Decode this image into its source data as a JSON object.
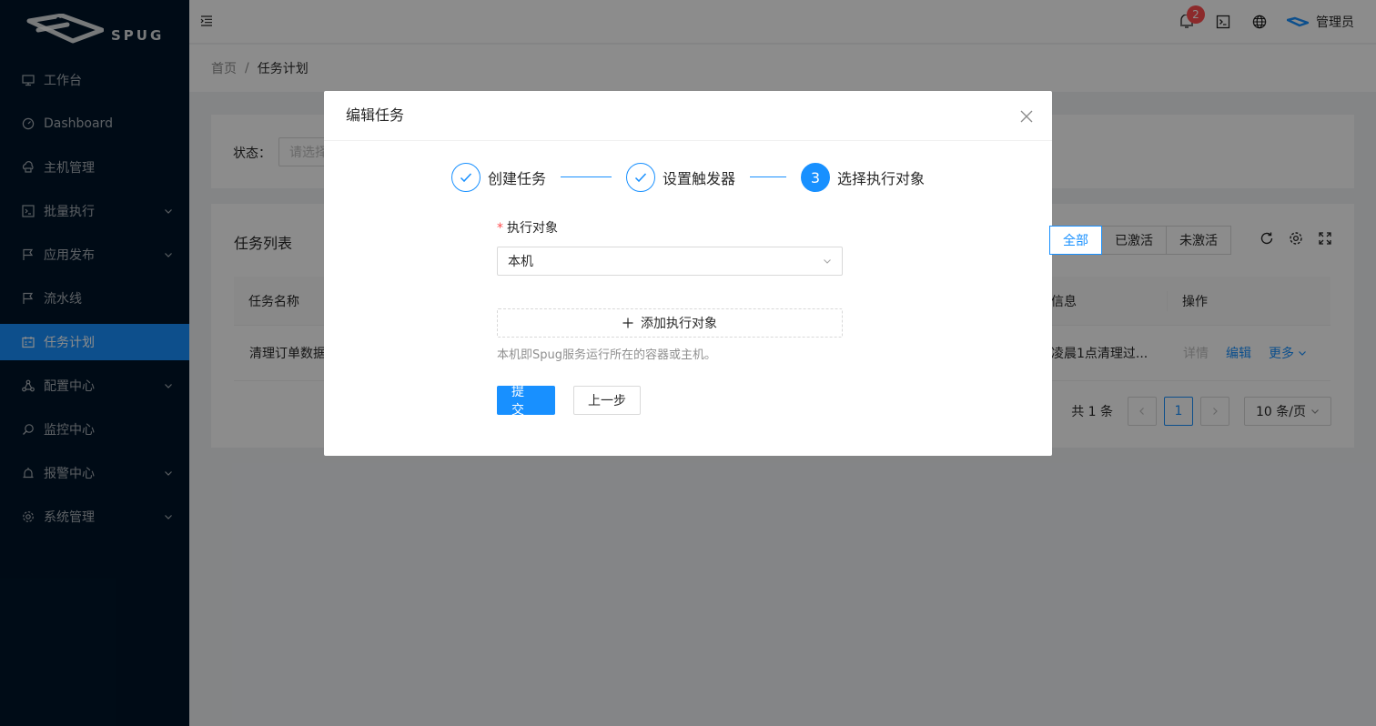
{
  "app": {
    "logo_text": "SPUG"
  },
  "sidebar": {
    "items": [
      {
        "label": "工作台"
      },
      {
        "label": "Dashboard"
      },
      {
        "label": "主机管理"
      },
      {
        "label": "批量执行"
      },
      {
        "label": "应用发布"
      },
      {
        "label": "流水线"
      },
      {
        "label": "任务计划"
      },
      {
        "label": "配置中心"
      },
      {
        "label": "监控中心"
      },
      {
        "label": "报警中心"
      },
      {
        "label": "系统管理"
      }
    ]
  },
  "header": {
    "notification_count": "2",
    "user_name": "管理员"
  },
  "breadcrumb": {
    "home": "首页",
    "separator": "/",
    "current": "任务计划"
  },
  "filter": {
    "status_label": "状态：",
    "status_placeholder": "请选择"
  },
  "table": {
    "title": "任务列表",
    "segments": [
      "全部",
      "已激活",
      "未激活"
    ],
    "columns": {
      "name": "任务名称",
      "info": "信息",
      "actions": "操作"
    },
    "rows": [
      {
        "name": "清理订单数据",
        "info": "凌晨1点清理过...",
        "detail": "详情",
        "edit": "编辑",
        "more": "更多"
      }
    ],
    "pagination": {
      "total": "共 1 条",
      "page": "1",
      "page_size": "10 条/页"
    }
  },
  "modal": {
    "title": "编辑任务",
    "steps": [
      {
        "title": "创建任务",
        "status": "finish"
      },
      {
        "title": "设置触发器",
        "status": "finish"
      },
      {
        "title": "选择执行对象",
        "status": "process",
        "number": "3"
      }
    ],
    "form": {
      "required_mark": "*",
      "target_label": "执行对象",
      "target_value": "本机",
      "add_target_label": "添加执行对象",
      "help_text": "本机即Spug服务运行所在的容器或主机。",
      "submit_label": "提交",
      "prev_label": "上一步"
    }
  },
  "colors": {
    "primary": "#1890ff",
    "sidebar_bg": "#001529",
    "danger": "#ff4d4f"
  }
}
